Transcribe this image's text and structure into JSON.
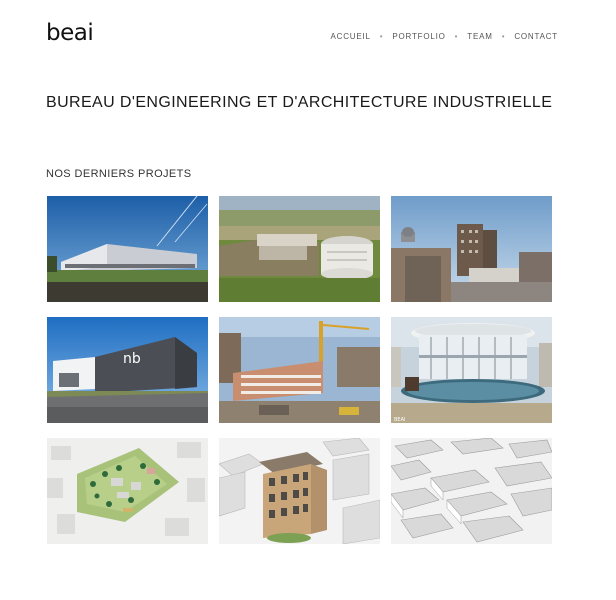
{
  "header": {
    "logo": "beai",
    "nav": [
      {
        "label": "ACCUEIL"
      },
      {
        "label": "PORTFOLIO"
      },
      {
        "label": "TEAM"
      },
      {
        "label": "CONTACT"
      }
    ],
    "separator": "•"
  },
  "main": {
    "title": "BUREAU D'ENGINEERING ET D'ARCHITECTURE INDUSTRIELLE",
    "section_title": "NOS DERNIERS PROJETS"
  },
  "projects": [
    {
      "icon": "industrial-hall-photo"
    },
    {
      "icon": "round-tank-building-photo"
    },
    {
      "icon": "city-buildings-photo"
    },
    {
      "icon": "nb-building-photo"
    },
    {
      "icon": "construction-site-photo"
    },
    {
      "icon": "pavilion-render",
      "sign": "BEAI"
    },
    {
      "icon": "site-plan-render"
    },
    {
      "icon": "apartment-building-render"
    },
    {
      "icon": "city-block-render"
    }
  ],
  "colors": {
    "text": "#1a1a1a",
    "nav": "#555555",
    "background": "#ffffff"
  }
}
